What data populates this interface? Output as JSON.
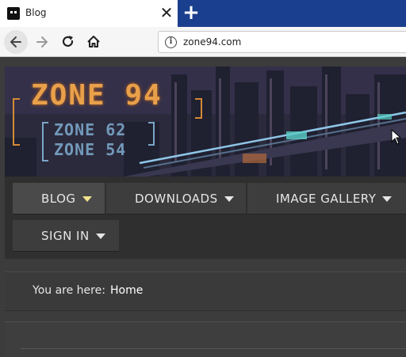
{
  "browser": {
    "tab_title": "Blog",
    "tab_close": "✕",
    "new_tab": "+",
    "url": "zone94.com",
    "info_icon": "i"
  },
  "site": {
    "logo_main": "ZONE 94",
    "logo_sub1": "ZONE 62",
    "logo_sub2": "ZONE 54"
  },
  "menu": {
    "items": [
      {
        "label": "BLOG",
        "active": true
      },
      {
        "label": "DOWNLOADS",
        "active": false
      },
      {
        "label": "IMAGE GALLERY",
        "active": false
      },
      {
        "label": "SIGN IN",
        "active": false
      }
    ]
  },
  "breadcrumb": {
    "label": "You are here:",
    "current": "Home"
  },
  "icons": [
    "favicon",
    "close-icon",
    "new-tab-icon",
    "back-arrow-icon",
    "forward-arrow-icon",
    "reload-icon",
    "home-icon",
    "info-icon",
    "caret-down-icon",
    "mouse-cursor-icon"
  ],
  "colors": {
    "tabstrip": "#1b3f8f",
    "site_bg": "#3c3c3c",
    "logo_orange": "#e8a04a",
    "logo_blue": "#7aa6c8",
    "active_caret": "#f2e48c"
  }
}
